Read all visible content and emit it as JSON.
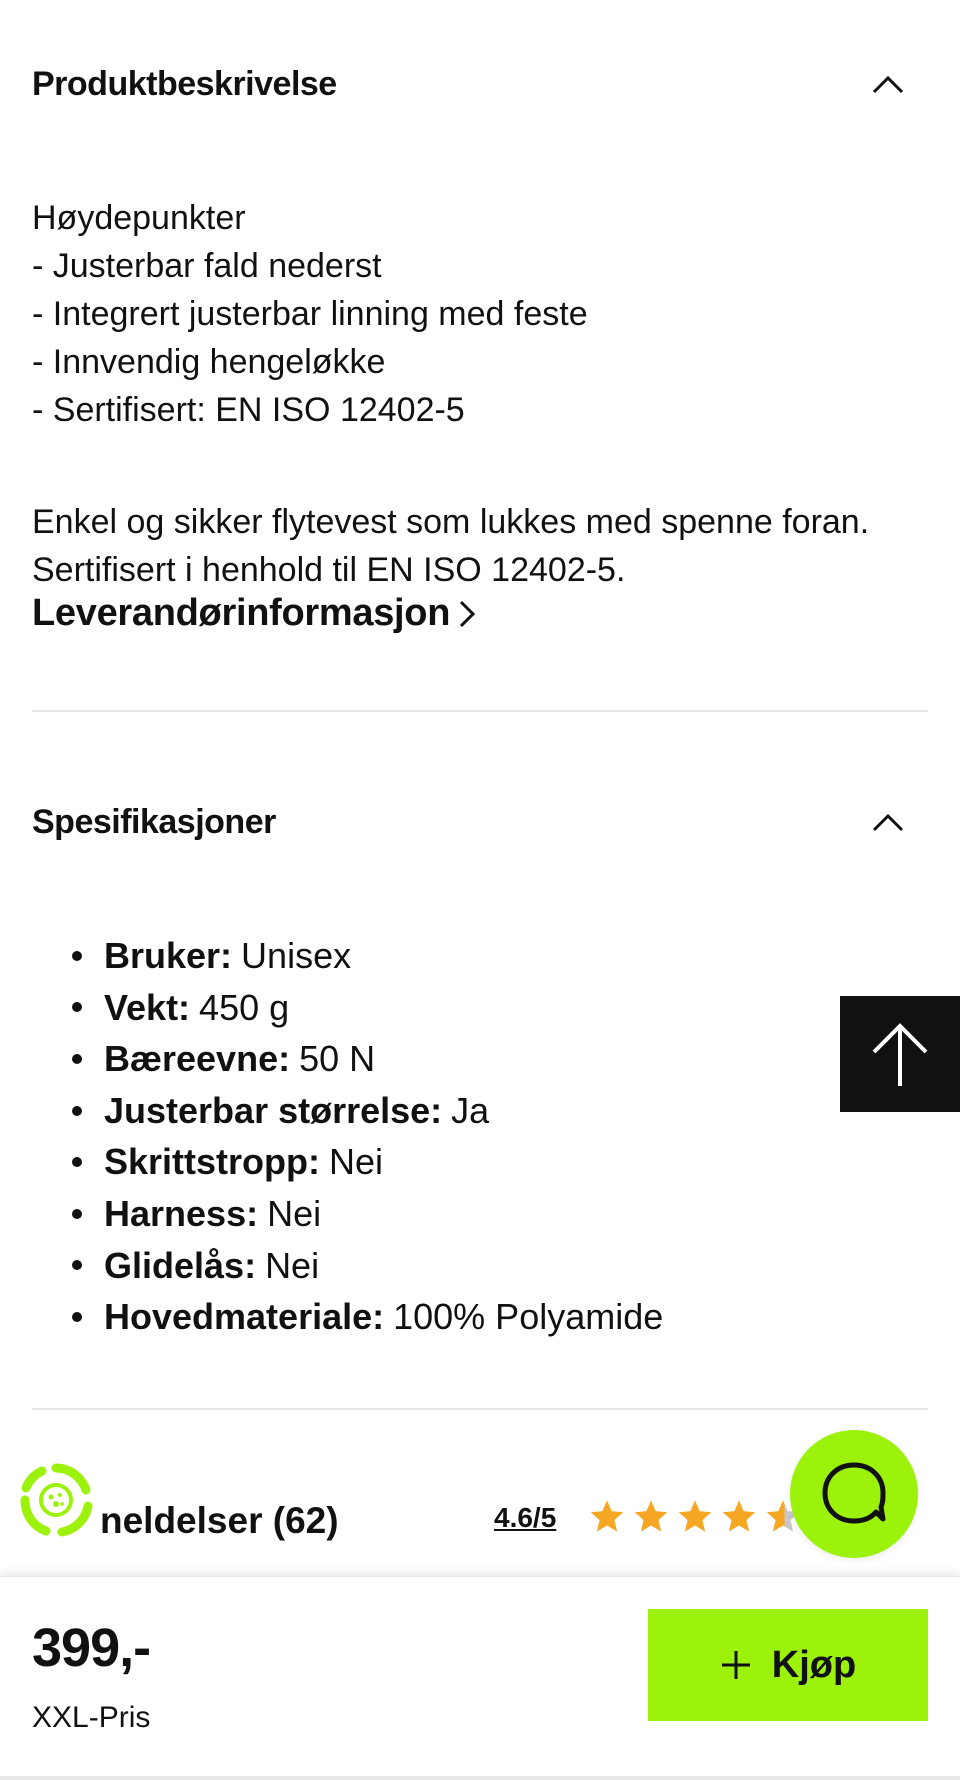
{
  "description_section": {
    "title": "Produktbeskrivelse",
    "highlights": [
      "Høydepunkter",
      "- Justerbar fald nederst",
      "- Integrert justerbar linning med feste",
      "- Innvendig hengeløkke",
      "- Sertifisert: EN ISO 12402-5"
    ],
    "body": "Enkel og sikker flytevest som lukkes med spenne foran. Sertifisert i henhold til EN ISO 12402-5.",
    "supplier_link": "Leverandørinformasjon"
  },
  "specs_section": {
    "title": "Spesifikasjoner",
    "items": [
      {
        "label": "Bruker:",
        "value": "Unisex"
      },
      {
        "label": "Vekt:",
        "value": "450 g"
      },
      {
        "label": "Bæreevne:",
        "value": "50 N"
      },
      {
        "label": "Justerbar størrelse:",
        "value": "Ja"
      },
      {
        "label": "Skrittstropp:",
        "value": "Nei"
      },
      {
        "label": "Harness:",
        "value": "Nei"
      },
      {
        "label": "Glidelås:",
        "value": "Nei"
      },
      {
        "label": "Hovedmateriale:",
        "value": "100% Polyamide"
      }
    ]
  },
  "reviews": {
    "title_visible": "neldelser (62)",
    "rating": "4.6/5",
    "stars": 4.6
  },
  "bottom_bar": {
    "price": "399,-",
    "price_label": "XXL-Pris",
    "buy_label": "Kjøp"
  },
  "colors": {
    "accent": "#9cf20a",
    "star": "#f5a623",
    "dark": "#111111"
  },
  "icons": {
    "collapse": "chevron-up-icon",
    "scroll_top": "arrow-up-icon",
    "chat": "chat-bubble-icon",
    "add": "plus-icon",
    "eco": "recycle-badge-icon"
  }
}
